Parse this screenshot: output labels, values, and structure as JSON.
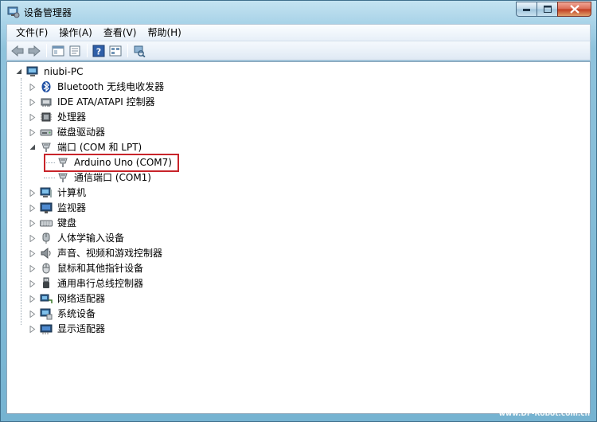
{
  "window": {
    "title": "设备管理器"
  },
  "menu": [
    "文件(F)",
    "操作(A)",
    "查看(V)",
    "帮助(H)"
  ],
  "toolbar": {
    "buttons": [
      "back-arrow-icon",
      "forward-arrow-icon",
      "show-hide-tree-icon",
      "properties-icon",
      "help-icon",
      "view-icon",
      "scan-hardware-icon"
    ]
  },
  "tree": {
    "root": "niubi-PC",
    "items": [
      {
        "label": "Bluetooth 无线电收发器",
        "icon": "bluetooth-icon"
      },
      {
        "label": "IDE ATA/ATAPI 控制器",
        "icon": "ide-controller-icon"
      },
      {
        "label": "处理器",
        "icon": "processor-icon"
      },
      {
        "label": "磁盘驱动器",
        "icon": "disk-drive-icon"
      },
      {
        "label": "端口 (COM 和 LPT)",
        "icon": "port-icon",
        "expanded": true,
        "children": [
          {
            "label": "Arduino Uno (COM7)",
            "icon": "port-icon",
            "highlighted": true
          },
          {
            "label": "通信端口 (COM1)",
            "icon": "port-icon"
          }
        ]
      },
      {
        "label": "计算机",
        "icon": "computer-icon"
      },
      {
        "label": "监视器",
        "icon": "monitor-icon"
      },
      {
        "label": "键盘",
        "icon": "keyboard-icon"
      },
      {
        "label": "人体学输入设备",
        "icon": "hid-icon"
      },
      {
        "label": "声音、视频和游戏控制器",
        "icon": "speaker-icon"
      },
      {
        "label": "鼠标和其他指针设备",
        "icon": "mouse-icon"
      },
      {
        "label": "通用串行总线控制器",
        "icon": "usb-icon"
      },
      {
        "label": "网络适配器",
        "icon": "network-adapter-icon"
      },
      {
        "label": "系统设备",
        "icon": "system-device-icon"
      },
      {
        "label": "显示适配器",
        "icon": "display-adapter-icon"
      }
    ]
  },
  "highlight_color": "#c8242a",
  "watermark": "www.DF-Robot.com.cn"
}
